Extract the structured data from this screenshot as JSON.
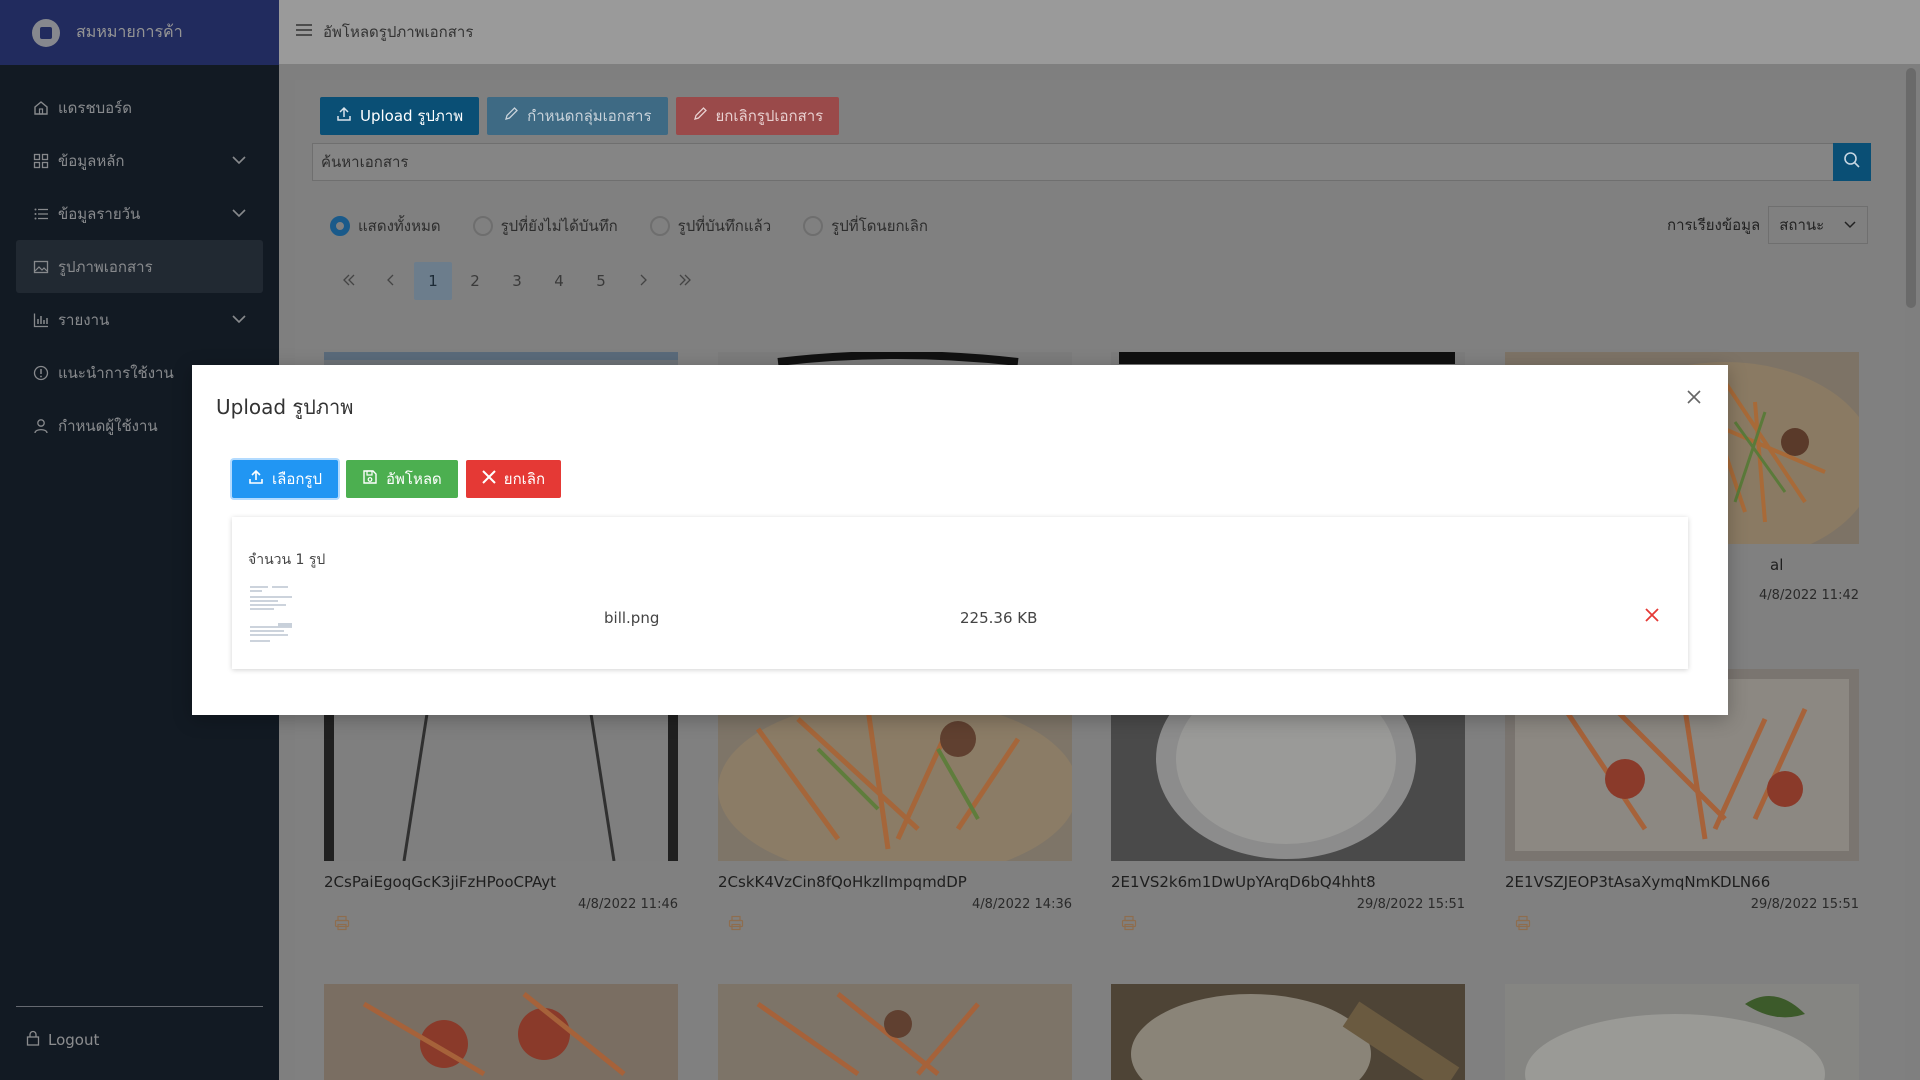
{
  "brand": {
    "name": "สมหมายการค้า"
  },
  "sidebar": {
    "items": [
      {
        "label": "แดรชบอร์ด",
        "icon": "home-icon",
        "has_submenu": false,
        "active": false
      },
      {
        "label": "ข้อมูลหลัก",
        "icon": "grid-icon",
        "has_submenu": true,
        "active": false
      },
      {
        "label": "ข้อมูลรายวัน",
        "icon": "list-icon",
        "has_submenu": true,
        "active": false
      },
      {
        "label": "รูปภาพเอกสาร",
        "icon": "image-icon",
        "has_submenu": false,
        "active": true
      },
      {
        "label": "รายงาน",
        "icon": "bar-chart-icon",
        "has_submenu": true,
        "active": false
      },
      {
        "label": "แนะนำการใช้งาน",
        "icon": "info-icon",
        "has_submenu": false,
        "active": false
      },
      {
        "label": "กำหนดผู้ใช้งาน",
        "icon": "user-icon",
        "has_submenu": false,
        "active": false
      }
    ],
    "logout_label": "Logout"
  },
  "header": {
    "title": "อัพโหลดรูปภาพเอกสาร"
  },
  "toolbar": {
    "upload_label": "Upload รูปภาพ",
    "group_label": "กำหนดกลุ่มเอกสาร",
    "cancel_label": "ยกเลิกรูปเอกสาร"
  },
  "search": {
    "placeholder": "ค้นหาเอกสาร"
  },
  "filters": {
    "options": [
      "แสดงทั้งหมด",
      "รูปที่ยังไม่ได้บันทึก",
      "รูปที่บันทึกแล้ว",
      "รูปที่โดนยกเลิก"
    ],
    "selected": 0
  },
  "sort": {
    "label": "การเรียงข้อมูล",
    "value": "สถานะ"
  },
  "pagination": {
    "pages": [
      "1",
      "2",
      "3",
      "4",
      "5"
    ],
    "current": "1"
  },
  "cards": {
    "row0_partial": {
      "label_fragment": "al",
      "date": "4/8/2022 11:42"
    },
    "row1": [
      {
        "title": "2CsPaiEgoqGcK3jiFzHPooCPAyt",
        "date": "4/8/2022 11:46"
      },
      {
        "title": "2CskK4VzCin8fQoHkzlImpqmdDP",
        "date": "4/8/2022 14:36"
      },
      {
        "title": "2E1VS2k6m1DwUpYArqD6bQ4hht8",
        "date": "29/8/2022 15:51"
      },
      {
        "title": "2E1VSZJEOP3tAsaXymqNmKDLN66",
        "date": "29/8/2022 15:51"
      }
    ]
  },
  "modal": {
    "title": "Upload รูปภาพ",
    "choose_label": "เลือกรูป",
    "upload_label": "อัพโหลด",
    "cancel_label": "ยกเลิก",
    "file_count": "จำนวน 1 รูป",
    "file": {
      "name": "bill.png",
      "size": "225.36 KB"
    }
  },
  "colors": {
    "sidebar_bg": "#1f2d3d",
    "brand_bg": "#3a4aa3",
    "primary": "#2196f3",
    "success": "#4caf50",
    "danger": "#e53935",
    "print_icon": "#f0a45e"
  }
}
